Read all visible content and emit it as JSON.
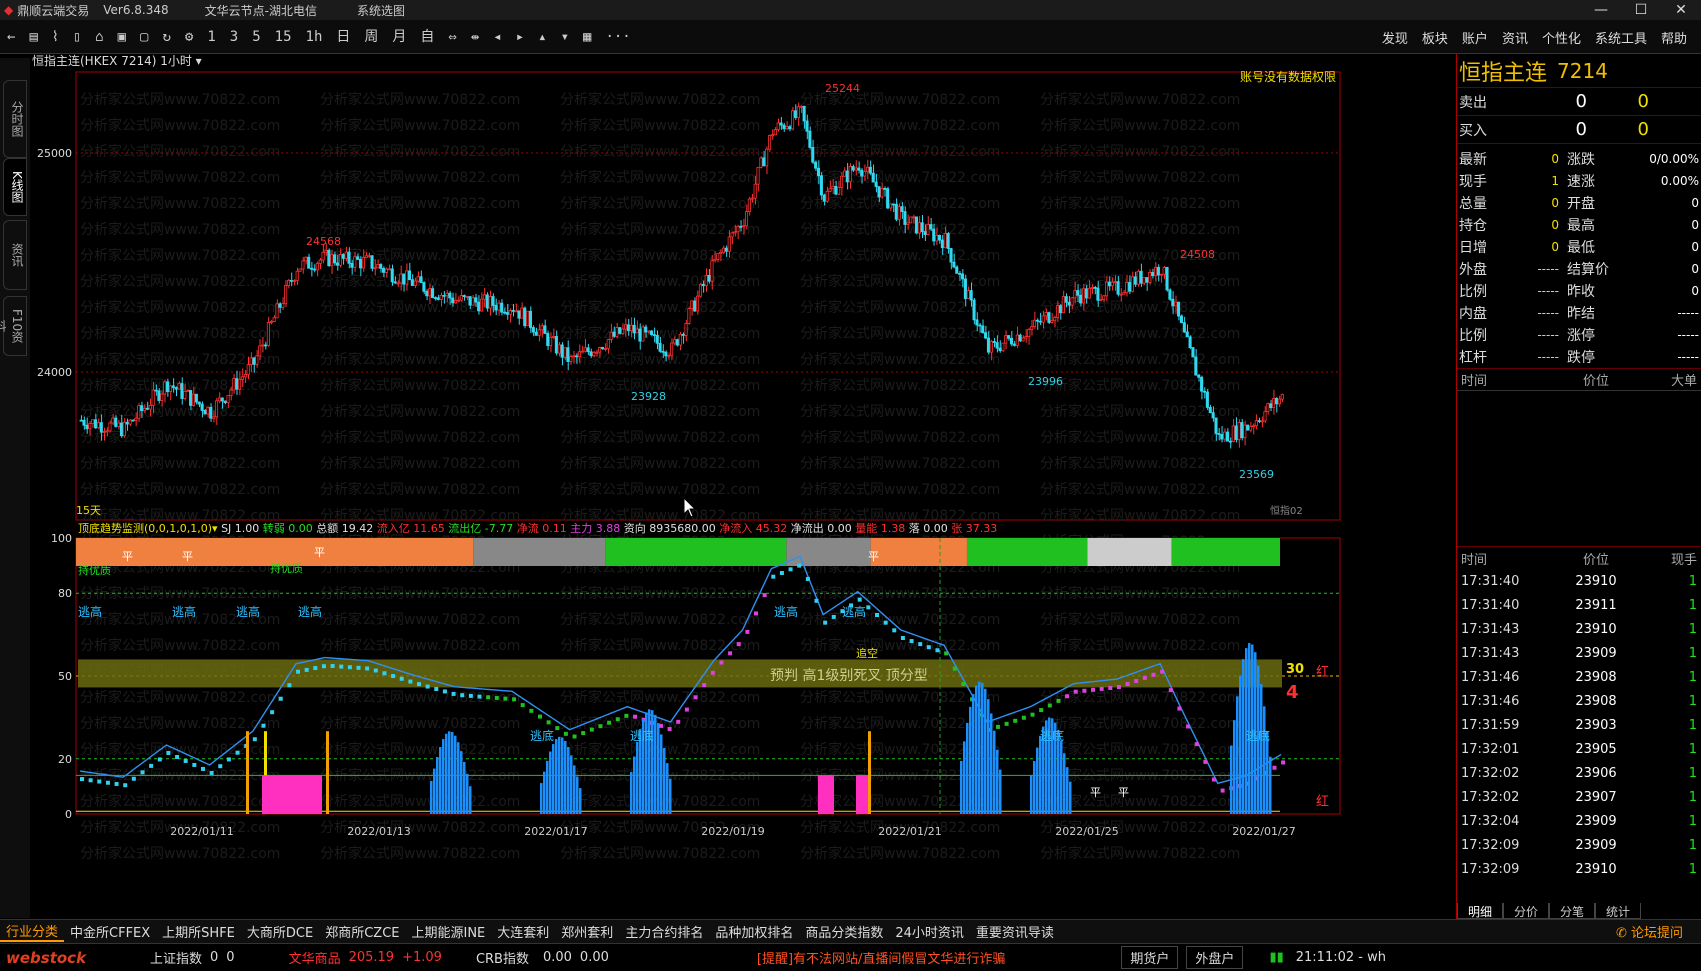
{
  "titlebar": {
    "app": "鼎顺云端交易",
    "version": "Ver6.8.348",
    "node": "文华云节点-湖北电信",
    "menu": "系统选图"
  },
  "window": {
    "min": "—",
    "max": "☐",
    "close": "✕"
  },
  "toolbar": {
    "icons": [
      "←",
      "▤",
      "⌇",
      "▯",
      "⌂",
      "▣",
      "▢",
      "↻",
      "⚙"
    ],
    "periods": [
      "1",
      "3",
      "5",
      "15",
      "1h",
      "日",
      "周",
      "月",
      "自"
    ],
    "tools": [
      "⇔",
      "⇹",
      "◂",
      "▸",
      "▴",
      "▾",
      "▦",
      "···"
    ]
  },
  "topnav": [
    "发现",
    "板块",
    "账户",
    "资讯",
    "个性化",
    "系统工具",
    "帮助"
  ],
  "lefttabs": [
    "分时图",
    "K线图",
    "资讯",
    "F10资料"
  ],
  "chart": {
    "header": "恒指主连(HKEX 7214)",
    "period": "1小时",
    "no_permission": "账号没有数据权限",
    "days": "15天",
    "footer_name": "恒指02",
    "y_labels": [
      "25000",
      "24000"
    ],
    "price_labels": [
      {
        "t": "25244",
        "c": "#ff3030"
      },
      {
        "t": "24568",
        "c": "#ff3030"
      },
      {
        "t": "24508",
        "c": "#ff3030"
      },
      {
        "t": "23928",
        "c": "#30d0e8"
      },
      {
        "t": "23996",
        "c": "#30d0e8"
      },
      {
        "t": "23569",
        "c": "#30d0e8"
      }
    ],
    "dates": [
      "2022/01/11",
      "2022/01/13",
      "2022/01/17",
      "2022/01/19",
      "2022/01/21",
      "2022/01/25",
      "2022/01/27"
    ],
    "watermark": "分析家公式网www.70822.com"
  },
  "indicator": {
    "name": "顶底趋势监测(0,0,1,0,1,0)",
    "values": [
      {
        "l": "SJ",
        "v": "1.00",
        "c": "#e0e0e0"
      },
      {
        "l": "转弱",
        "v": "0.00",
        "c": "#20e020"
      },
      {
        "l": "总额",
        "v": "19.42",
        "c": "#e0e0e0"
      },
      {
        "l": "流入亿",
        "v": "11.65",
        "c": "#ff3030"
      },
      {
        "l": "流出亿",
        "v": "-7.77",
        "c": "#20e020"
      },
      {
        "l": "净流",
        "v": "0.11",
        "c": "#ff3030"
      },
      {
        "l": "主力",
        "v": "3.88",
        "c": "#e040e0"
      },
      {
        "l": "资向",
        "v": "8935680.00",
        "c": "#e0e0e0"
      },
      {
        "l": "净流入",
        "v": "45.32",
        "c": "#ff3030"
      },
      {
        "l": "净流出",
        "v": "0.00",
        "c": "#e0e0e0"
      },
      {
        "l": "量能",
        "v": "1.38",
        "c": "#ff3030"
      },
      {
        "l": "落",
        "v": "0.00",
        "c": "#e0e0e0"
      },
      {
        "l": "张",
        "v": "37.33",
        "c": "#ff3030"
      }
    ],
    "y_labels": [
      "100",
      "80",
      "50",
      "20",
      "0"
    ],
    "labels": {
      "escape_high": "逃高",
      "escape_low": "逃底",
      "hold": "持优质",
      "flat": "平",
      "chase": "追空",
      "warn": "预判 高1级别死叉 顶分型",
      "n30": "30",
      "n4": "4",
      "red_tail": "红"
    }
  },
  "right": {
    "name": "恒指主连",
    "code": "7214",
    "sell": {
      "label": "卖出",
      "p": "0",
      "v": "0"
    },
    "buy": {
      "label": "买入",
      "p": "0",
      "v": "0"
    },
    "grid": [
      [
        "最新",
        "0",
        "涨跌",
        "0/0.00%"
      ],
      [
        "现手",
        "1",
        "速涨",
        "0.00%"
      ],
      [
        "总量",
        "0",
        "开盘",
        "0"
      ],
      [
        "持仓",
        "0",
        "最高",
        "0"
      ],
      [
        "日增",
        "0",
        "最低",
        "0"
      ],
      [
        "外盘",
        "-----",
        "结算价",
        "0"
      ],
      [
        "比例",
        "-----",
        "昨收",
        "0"
      ],
      [
        "内盘",
        "-----",
        "昨结",
        "-----"
      ],
      [
        "比例",
        "-----",
        "涨停",
        "-----"
      ],
      [
        "杠杆",
        "-----",
        "跌停",
        "-----"
      ]
    ],
    "sec1_headers": [
      "时间",
      "价位",
      "大单"
    ],
    "sec2_headers": [
      "时间",
      "价位",
      "现手"
    ],
    "ticks": [
      [
        "17:31:40",
        "23910",
        "1"
      ],
      [
        "17:31:40",
        "23911",
        "1"
      ],
      [
        "17:31:43",
        "23910",
        "1"
      ],
      [
        "17:31:43",
        "23909",
        "1"
      ],
      [
        "17:31:46",
        "23908",
        "1"
      ],
      [
        "17:31:46",
        "23908",
        "1"
      ],
      [
        "17:31:59",
        "23903",
        "1"
      ],
      [
        "17:32:01",
        "23905",
        "1"
      ],
      [
        "17:32:02",
        "23906",
        "1"
      ],
      [
        "17:32:02",
        "23907",
        "1"
      ],
      [
        "17:32:04",
        "23909",
        "1"
      ],
      [
        "17:32:09",
        "23909",
        "1"
      ],
      [
        "17:32:09",
        "23910",
        "1"
      ]
    ],
    "tabs": [
      "明细",
      "分价",
      "分笔",
      "统计"
    ]
  },
  "bottomtabs": [
    "行业分类",
    "中金所CFFEX",
    "上期所SHFE",
    "大商所DCE",
    "郑商所CZCE",
    "上期能源INE",
    "大连套利",
    "郑州套利",
    "主力合约排名",
    "品种加权排名",
    "商品分类指数",
    "24小时资讯",
    "重要资讯导读"
  ],
  "forum": "论坛提问",
  "status": {
    "logo": "webstock",
    "sh_label": "上证指数",
    "sh_v1": "0",
    "sh_v2": "0",
    "wh_label": "文华商品",
    "wh_v": "205.19",
    "wh_ch": "+1.09",
    "crb_label": "CRB指数",
    "crb_v1": "0.00",
    "crb_v2": "0.00",
    "notice": "[提醒]有不法网站/直播间假冒文华进行诈骗",
    "btn1": "期货户",
    "btn2": "外盘户",
    "time": "21:11:02 - wh"
  }
}
